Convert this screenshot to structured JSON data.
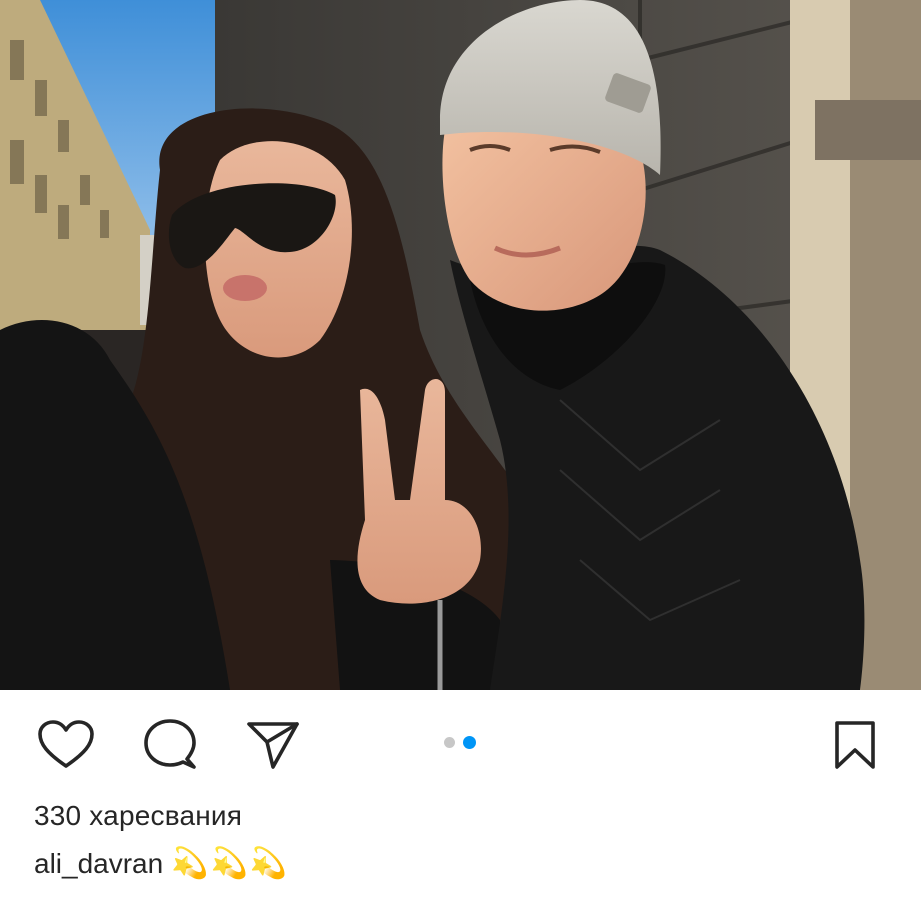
{
  "post": {
    "media": {
      "description_icon": "photo",
      "carousel": {
        "total": 2,
        "active_index": 1
      }
    },
    "actions": {
      "like_icon": "heart-icon",
      "comment_icon": "comment-icon",
      "share_icon": "send-icon",
      "save_icon": "bookmark-icon"
    },
    "likes_text": "330 харесвания",
    "caption": {
      "username": "ali_davran",
      "text": "💫💫💫"
    },
    "colors": {
      "accent": "#0095f6",
      "text": "#262626",
      "dot_inactive": "#c7c7c7",
      "background": "#ffffff"
    }
  }
}
